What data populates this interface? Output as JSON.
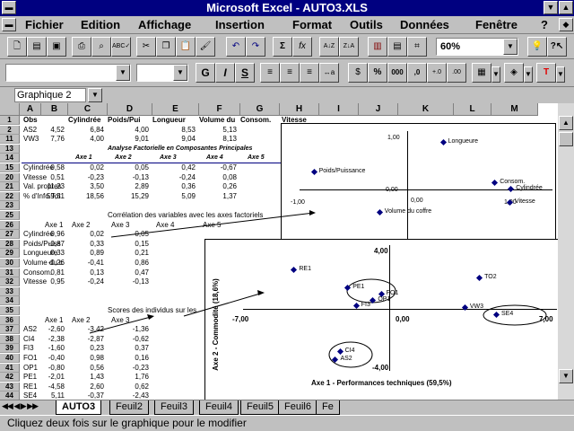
{
  "window": {
    "title": "Microsoft Excel - AUTO3.XLS"
  },
  "menu": [
    "Fichier",
    "Edition",
    "Affichage",
    "Insertion",
    "Format",
    "Outils",
    "Données",
    "Fenêtre",
    "?"
  ],
  "toolbar": {
    "zoom": "60%"
  },
  "format_toolbar": {
    "bold": "G",
    "italic": "I",
    "underline": "S",
    "percent": "%",
    "thousands": "000",
    "currency_dec": ",0"
  },
  "namebox": "Graphique 2",
  "columns": [
    "A",
    "B",
    "C",
    "D",
    "E",
    "F",
    "G",
    "H",
    "I",
    "J",
    "K",
    "L",
    "M"
  ],
  "rows": [
    "1",
    "2",
    "11",
    "13",
    "14",
    "15",
    "20",
    "21",
    "22",
    "23",
    "25",
    "26",
    "27",
    "28",
    "29",
    "30",
    "31",
    "32",
    "33",
    "34",
    "35",
    "36",
    "37",
    "38",
    "39",
    "40",
    "41",
    "42",
    "43",
    "44"
  ],
  "header_row": [
    "Obs",
    "Cylindrée",
    "Poids/Pui",
    "Longueur",
    "Volume du",
    "Consom.",
    "Vitesse"
  ],
  "data_rows": [
    [
      "AS2",
      "4,52",
      "6,84",
      "4,00",
      "8,53",
      "5,13"
    ],
    [
      "VW3",
      "7,76",
      "4,00",
      "9,01",
      "9,04",
      "8,13"
    ]
  ],
  "acp_title": "Analyse Factorielle en Composantes Principales",
  "acp_axes": [
    "Axe 1",
    "Axe 2",
    "Axe 3",
    "Axe 4",
    "Axe 5"
  ],
  "acp_rows": [
    [
      "Cylindrée",
      "0,58",
      "0,02",
      "0,05",
      "0,42",
      "-0,67"
    ],
    [
      "Vitesse",
      "0,51",
      "-0,23",
      "-0,13",
      "-0,24",
      "0,08"
    ],
    [
      "Val. propres",
      "11,23",
      "3,50",
      "2,89",
      "0,36",
      "0,26"
    ],
    [
      "% d'Info.Tot",
      "59,51",
      "18,56",
      "15,29",
      "5,09",
      "1,37"
    ]
  ],
  "corr_title": "Corrélation des variables avec les axes factoriels",
  "corr_axes": [
    "Axe 1",
    "Axe 2",
    "Axe 3",
    "Axe 4",
    "Axe 5"
  ],
  "corr_rows": [
    [
      "Cylindrée",
      "0,96",
      "0,02",
      "0,05"
    ],
    [
      "Poids/Puiss",
      "-0,87",
      "0,33",
      "0,15"
    ],
    [
      "Longueure",
      "0,33",
      "0,89",
      "0,21"
    ],
    [
      "Volume du c",
      "-0,26",
      "-0,41",
      "0,86"
    ],
    [
      "Consom.",
      "0,81",
      "0,13",
      "0,47"
    ],
    [
      "Vitesse",
      "0,95",
      "-0,24",
      "-0,13"
    ]
  ],
  "scores_title": "Scores des individus sur les",
  "scores_axes": [
    "Axe 1",
    "Axe 2",
    "Axe 3"
  ],
  "scores_rows": [
    [
      "AS2",
      "-2,60",
      "-3,42",
      "-1,36"
    ],
    [
      "CI4",
      "-2,38",
      "-2,87",
      "-0,62"
    ],
    [
      "FI3",
      "-1,60",
      "0,23",
      "0,37"
    ],
    [
      "FO1",
      "-0,40",
      "0,98",
      "0,16"
    ],
    [
      "OP1",
      "-0,80",
      "0,56",
      "-0,23"
    ],
    [
      "PE1",
      "-2,01",
      "1,43",
      "1,76"
    ],
    [
      "RE1",
      "-4,58",
      "2,60",
      "0,62"
    ],
    [
      "SE4",
      "5,11",
      "-0,37",
      "-2,43"
    ]
  ],
  "chart_data": [
    {
      "type": "scatter",
      "title": "",
      "ticks": {
        "top": "1,00",
        "middle": "0,00",
        "bottom": "-1,00",
        "left": "-1,00",
        "center": "0,00",
        "right": "1,00"
      },
      "points": [
        {
          "label": "Longueure",
          "x": 0.33,
          "y": 0.89
        },
        {
          "label": "Poids/Puissance",
          "x": -0.87,
          "y": 0.33
        },
        {
          "label": "Consom.",
          "x": 0.81,
          "y": 0.13
        },
        {
          "label": "Cylindrée",
          "x": 0.96,
          "y": 0.02
        },
        {
          "label": "Vitesse",
          "x": 0.95,
          "y": -0.24
        },
        {
          "label": "Volume du coffre",
          "x": -0.26,
          "y": -0.41
        }
      ]
    },
    {
      "type": "scatter",
      "title": "",
      "xlabel": "Axe 1 - Performances techniques (59,5%)",
      "ylabel": "Axe 2 - Commodité (18,6%)",
      "ticks": {
        "top": "4,00",
        "bottom": "-4,00",
        "left": "-7,00",
        "center": "0,00",
        "right": "7,00"
      },
      "xlim": [
        -7,
        7
      ],
      "ylim": [
        -4,
        4
      ],
      "points": [
        {
          "label": "RE1",
          "x": -4.58,
          "y": 2.6
        },
        {
          "label": "PE1",
          "x": -2.01,
          "y": 1.43
        },
        {
          "label": "FO1",
          "x": -0.4,
          "y": 0.98
        },
        {
          "label": "OP1",
          "x": -0.8,
          "y": 0.56
        },
        {
          "label": "FI3",
          "x": -1.6,
          "y": 0.23
        },
        {
          "label": "TO2",
          "x": 4.3,
          "y": 2.1
        },
        {
          "label": "VW3",
          "x": 3.6,
          "y": 0.1
        },
        {
          "label": "SE4",
          "x": 5.11,
          "y": -0.37
        },
        {
          "label": "CI4",
          "x": -2.38,
          "y": -2.87
        },
        {
          "label": "AS2",
          "x": -2.6,
          "y": -3.42
        }
      ]
    }
  ],
  "sheet_tabs": [
    "AUTO3",
    "Feuil2",
    "Feuil3",
    "Feuil4",
    "Feuil5",
    "Feuil6",
    "Fe"
  ],
  "status": "Cliquez deux fois sur le graphique pour le modifier"
}
